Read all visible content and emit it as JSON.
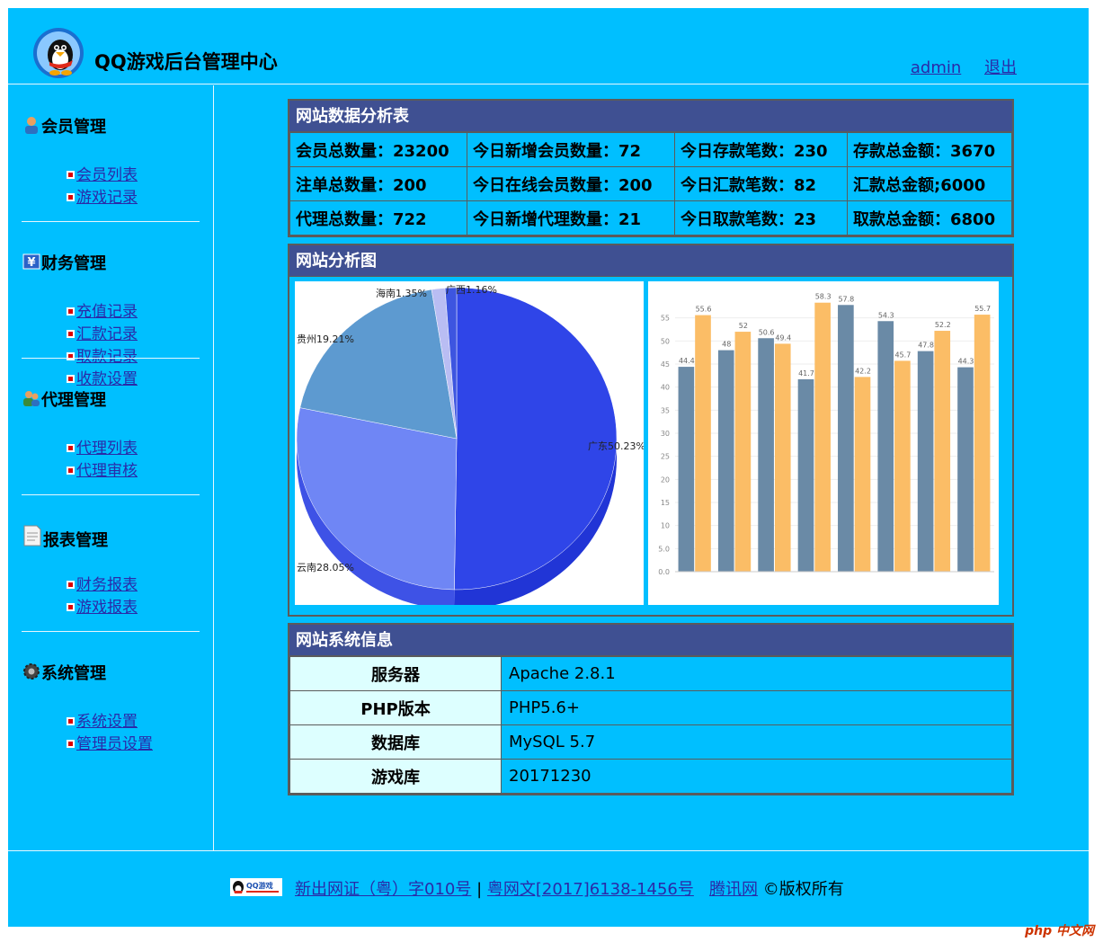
{
  "header": {
    "title": "QQ游戏后台管理中心",
    "user": "admin",
    "logout": "退出"
  },
  "sidebar": {
    "groups": [
      {
        "title": "会员管理",
        "icon": "user-icon",
        "items": [
          "会员列表",
          "游戏记录"
        ]
      },
      {
        "title": "财务管理",
        "icon": "yen-icon",
        "items": [
          "充值记录",
          "汇款记录",
          "取款记录",
          "收款设置"
        ]
      },
      {
        "title": "代理管理",
        "icon": "agent-icon",
        "items": [
          "代理列表",
          "代理审核"
        ]
      },
      {
        "title": "报表管理",
        "icon": "report-icon",
        "items": [
          "财务报表",
          "游戏报表"
        ]
      },
      {
        "title": "系统管理",
        "icon": "gear-icon",
        "items": [
          "系统设置",
          "管理员设置"
        ]
      }
    ]
  },
  "stats_panel": {
    "title": "网站数据分析表",
    "rows": [
      [
        "会员总数量：23200",
        "今日新增会员数量：72",
        "今日存款笔数：230",
        "存款总金额：3670"
      ],
      [
        "注单总数量：200",
        "今日在线会员数量：200",
        "今日汇款笔数：82",
        "汇款总金额;6000"
      ],
      [
        "代理总数量：722",
        "今日新增代理数量：21",
        "今日取款笔数：23",
        "取款总金额：6800"
      ]
    ]
  },
  "chart_panel": {
    "title": "网站分析图"
  },
  "chart_data": [
    {
      "type": "pie",
      "slices": [
        {
          "label": "广东50.23%",
          "value": 50.23,
          "color": "#2f45e8"
        },
        {
          "label": "云南28.05%",
          "value": 28.05,
          "color": "#6f86f5"
        },
        {
          "label": "贵州19.21%",
          "value": 19.21,
          "color": "#5d9ad0"
        },
        {
          "label": "海南1.35%",
          "value": 1.35,
          "color": "#b9bdf3"
        },
        {
          "label": "广西1.16%",
          "value": 1.16,
          "color": "#3d55e0"
        }
      ]
    },
    {
      "type": "bar",
      "categories": [
        "",
        "",
        "",
        "",
        "",
        "",
        "",
        ""
      ],
      "series": [
        {
          "values": [
            44.4,
            48,
            50.6,
            41.7,
            57.8,
            54.3,
            47.8,
            44.3
          ],
          "color": "#6a8aa6"
        },
        {
          "values": [
            55.6,
            52,
            49.4,
            58.3,
            42.2,
            45.7,
            52.2,
            55.7
          ],
          "color": "#fbbd66"
        }
      ],
      "ylim": [
        0,
        60
      ],
      "yticks": [
        "0.0",
        "5.0",
        "10",
        "15",
        "20",
        "25",
        "30",
        "35",
        "40",
        "45",
        "50",
        "55"
      ]
    }
  ],
  "sys_panel": {
    "title": "网站系统信息",
    "rows": [
      {
        "key": "服务器",
        "value": "Apache 2.8.1"
      },
      {
        "key": "PHP版本",
        "value": "PHP5.6+"
      },
      {
        "key": "数据库",
        "value": "MySQL 5.7"
      },
      {
        "key": "游戏库",
        "value": "20171230"
      }
    ]
  },
  "footer": {
    "license1": "新出网证（粤）字010号",
    "sep": "|",
    "license2": "粤网文[2017]6138-1456号",
    "company": "腾讯网",
    "copyright": "©版权所有"
  },
  "watermark": "php 中文网"
}
